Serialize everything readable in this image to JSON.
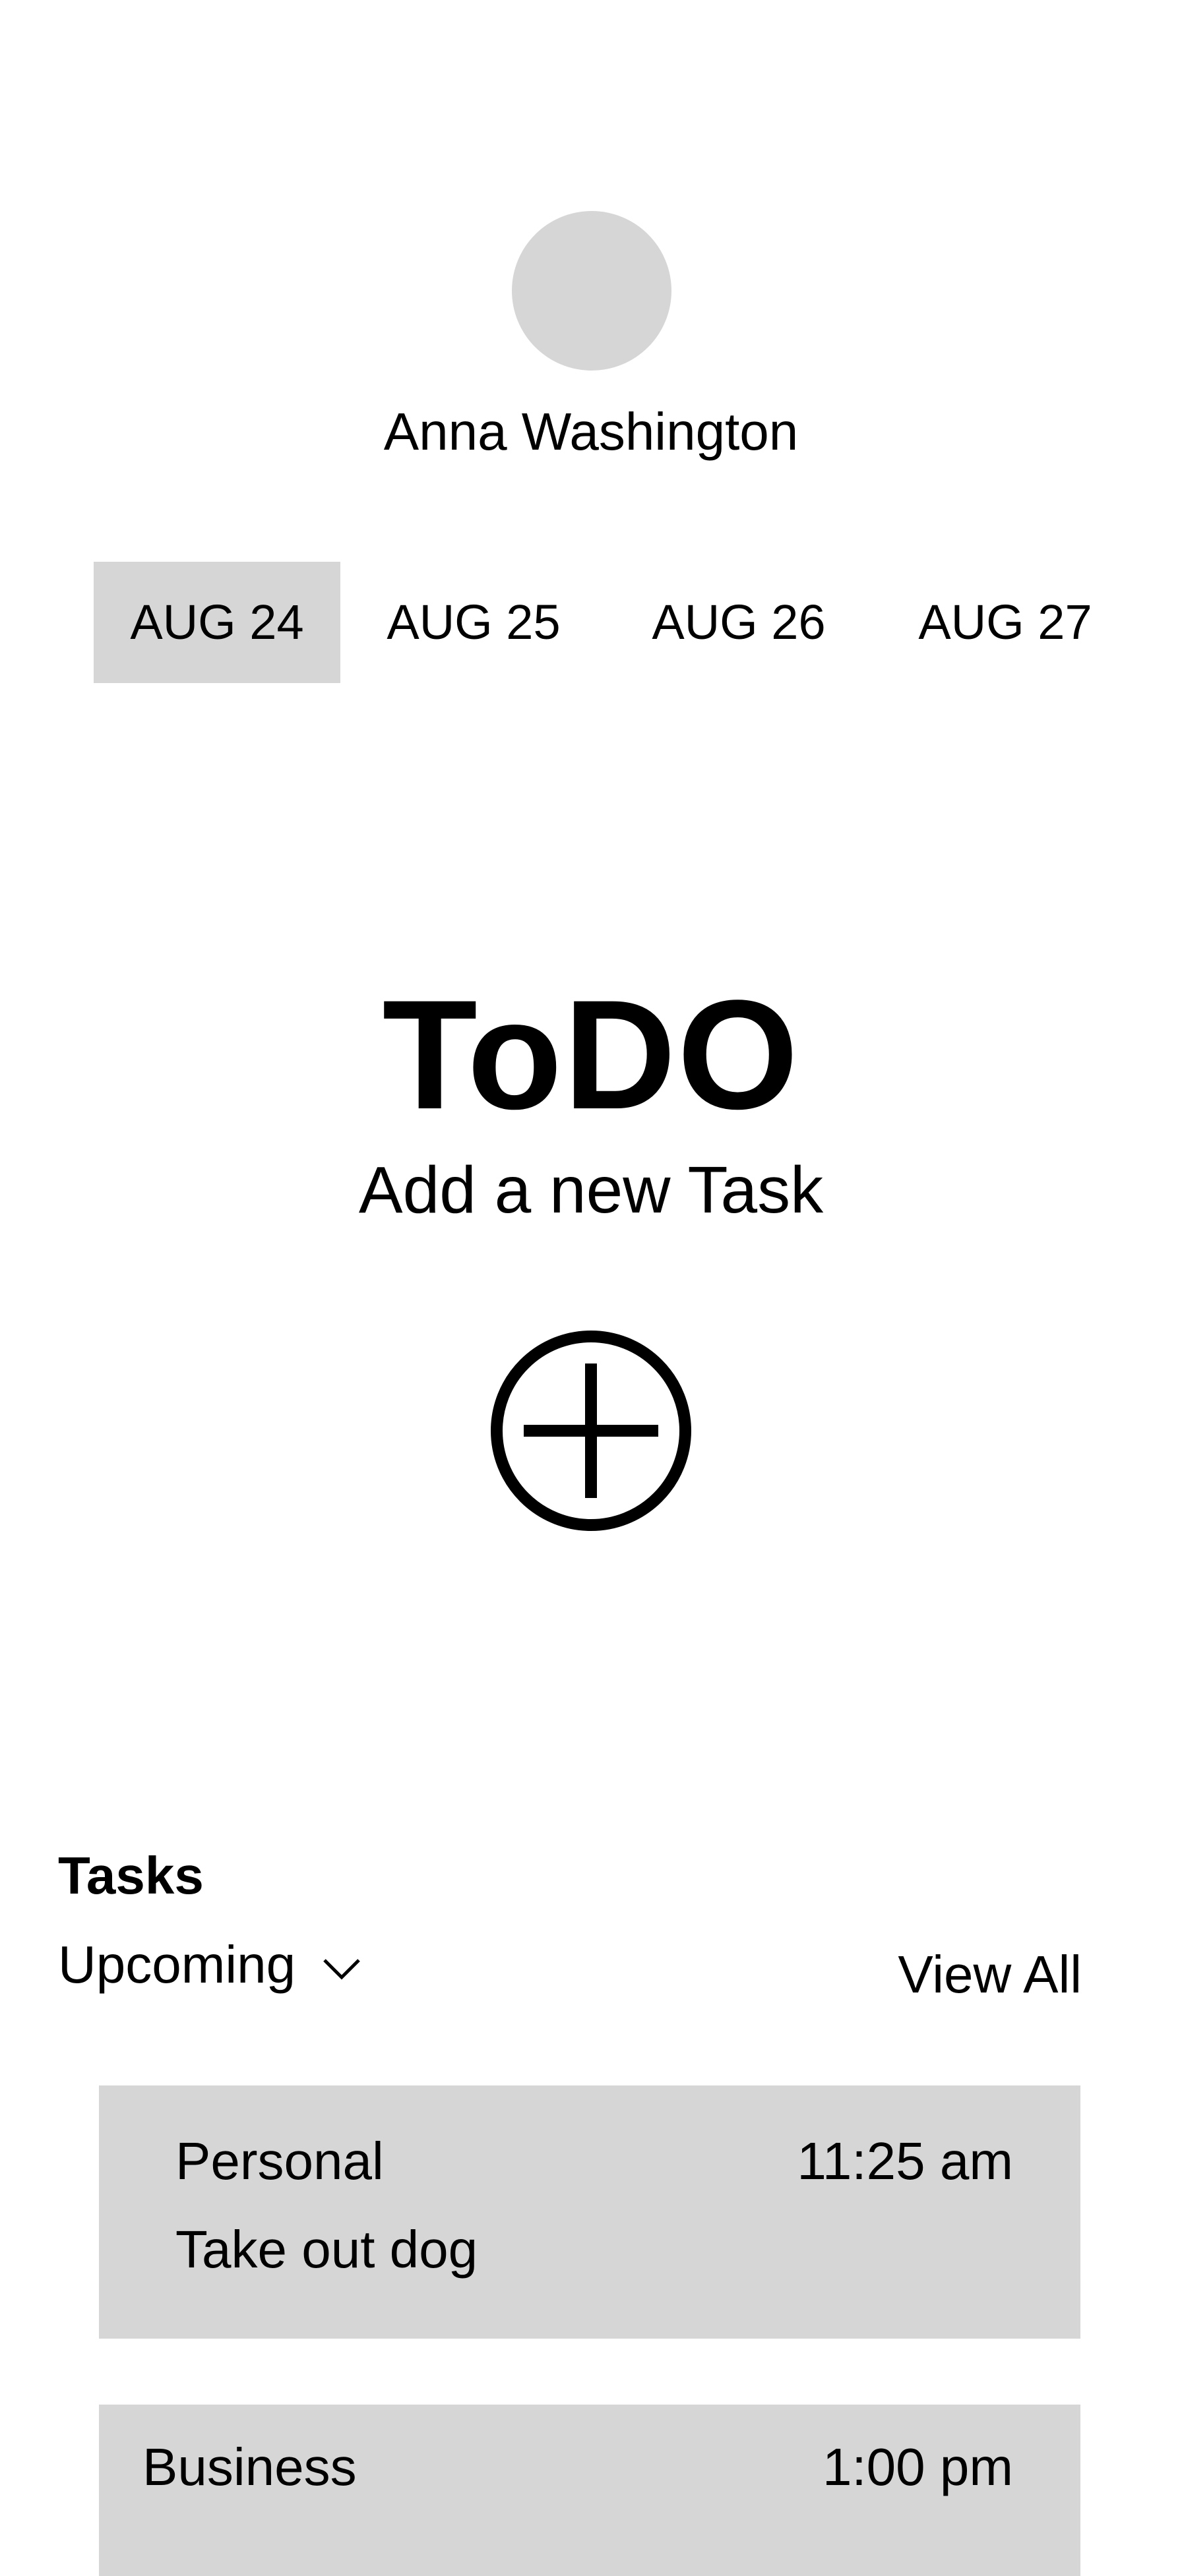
{
  "profile": {
    "name": "Anna Washington"
  },
  "dates": [
    {
      "label": "AUG 24",
      "selected": true
    },
    {
      "label": "AUG 25",
      "selected": false
    },
    {
      "label": "AUG 26",
      "selected": false
    },
    {
      "label": "AUG 27",
      "selected": false
    }
  ],
  "hero": {
    "title": "ToDO",
    "subtitle": "Add a new Task",
    "add_icon": "plus-circle-icon"
  },
  "tasks": {
    "heading": "Tasks",
    "filter_label": "Upcoming",
    "filter_icon": "chevron-down-icon",
    "view_all_label": "View All",
    "items": [
      {
        "category": "Personal",
        "time": "11:25 am",
        "description": "Take out dog"
      },
      {
        "category": "Business",
        "time": "1:00 pm"
      }
    ]
  },
  "colors": {
    "background": "#ffffff",
    "placeholder_gray": "#d6d6d6",
    "text": "#000000"
  }
}
